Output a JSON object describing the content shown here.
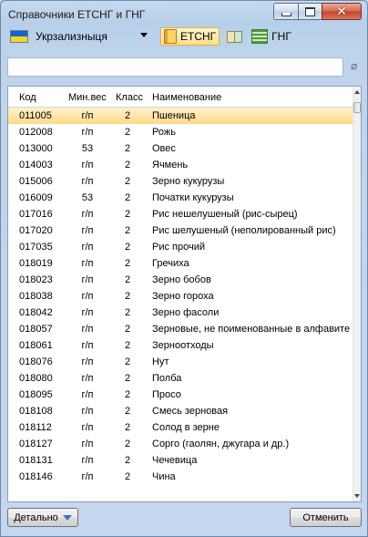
{
  "window": {
    "title": "Справочники ЕТСНГ и ГНГ"
  },
  "toolbar": {
    "railway": "Укрзализныця",
    "tab_etsng": "ЕТСНГ",
    "tab_gng": "ГНГ"
  },
  "search": {
    "value": ""
  },
  "table": {
    "columns": [
      "Код",
      "Мин.вес",
      "Класс",
      "Наименование"
    ],
    "rows": [
      [
        "011005",
        "г/п",
        "2",
        "Пшеница"
      ],
      [
        "012008",
        "г/п",
        "2",
        "Рожь"
      ],
      [
        "013000",
        "53",
        "2",
        "Овес"
      ],
      [
        "014003",
        "г/п",
        "2",
        "Ячмень"
      ],
      [
        "015006",
        "г/п",
        "2",
        "Зерно кукурузы"
      ],
      [
        "016009",
        "53",
        "2",
        "Початки кукурузы"
      ],
      [
        "017016",
        "г/п",
        "2",
        "Рис нешелушеный (рис-сырец)"
      ],
      [
        "017020",
        "г/п",
        "2",
        "Рис шелушеный (неполированный рис)"
      ],
      [
        "017035",
        "г/п",
        "2",
        "Рис прочий"
      ],
      [
        "018019",
        "г/п",
        "2",
        "Гречиха"
      ],
      [
        "018023",
        "г/п",
        "2",
        "Зерно бобов"
      ],
      [
        "018038",
        "г/п",
        "2",
        "Зерно гороха"
      ],
      [
        "018042",
        "г/п",
        "2",
        "Зерно фасоли"
      ],
      [
        "018057",
        "г/п",
        "2",
        "Зерновые, не поименованные в алфавите"
      ],
      [
        "018061",
        "г/п",
        "2",
        "Зерноотходы"
      ],
      [
        "018076",
        "г/п",
        "2",
        "Нут"
      ],
      [
        "018080",
        "г/п",
        "2",
        "Полба"
      ],
      [
        "018095",
        "г/п",
        "2",
        "Просо"
      ],
      [
        "018108",
        "г/п",
        "2",
        "Смесь зерновая"
      ],
      [
        "018112",
        "г/п",
        "2",
        "Солод в зерне"
      ],
      [
        "018127",
        "г/п",
        "2",
        "Сорго (гаолян, джугара и др.)"
      ],
      [
        "018131",
        "г/п",
        "2",
        "Чечевица"
      ],
      [
        "018146",
        "г/п",
        "2",
        "Чина"
      ]
    ]
  },
  "footer": {
    "details_label": "Детально",
    "cancel_label": "Отменить"
  }
}
